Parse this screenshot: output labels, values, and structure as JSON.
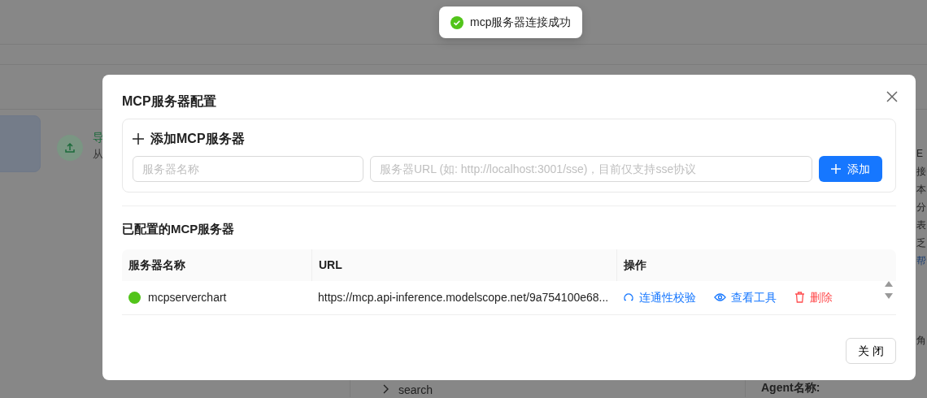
{
  "toast": {
    "text": "mcp服务器连接成功"
  },
  "background": {
    "card_title": "导",
    "card_subtitle": "从",
    "side_texts": [
      "E",
      "接",
      "本",
      "分",
      "表",
      "乏",
      "帮"
    ],
    "side_label": "角",
    "agent_label": "Agent名称:",
    "tree_item": "search"
  },
  "modal": {
    "title": "MCP服务器配置",
    "add_section": {
      "title": "添加MCP服务器",
      "name_placeholder": "服务器名称",
      "url_placeholder": "服务器URL (如: http://localhost:3001/sse)，目前仅支持sse协议",
      "add_button": "添加"
    },
    "configured_title": "已配置的MCP服务器",
    "table": {
      "columns": [
        "服务器名称",
        "URL",
        "操作"
      ],
      "rows": [
        {
          "name": "mcpserverchart",
          "color": "#52c41a",
          "url": "https://mcp.api-inference.modelscope.net/9a754100e68...",
          "actions": [
            {
              "label": "连通性校验",
              "kind": "check"
            },
            {
              "label": "查看工具",
              "kind": "view"
            },
            {
              "label": "删除",
              "kind": "delete"
            }
          ]
        }
      ]
    },
    "close_button": "关 闭"
  }
}
